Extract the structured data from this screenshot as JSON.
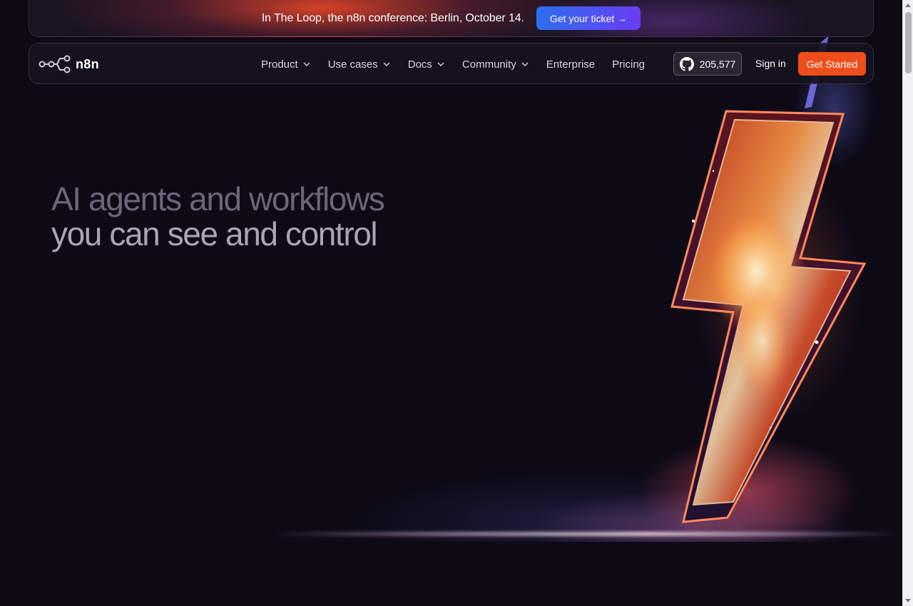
{
  "banner": {
    "text": "In The Loop, the n8n conference: Berlin, October 14.",
    "button_label": "Get your ticket",
    "button_arrow": "→"
  },
  "nav": {
    "logo_text": "n8n",
    "items": [
      {
        "label": "Product",
        "has_dropdown": true
      },
      {
        "label": "Use cases",
        "has_dropdown": true
      },
      {
        "label": "Docs",
        "has_dropdown": true
      },
      {
        "label": "Community",
        "has_dropdown": true
      },
      {
        "label": "Enterprise",
        "has_dropdown": false
      },
      {
        "label": "Pricing",
        "has_dropdown": false
      }
    ],
    "github_stars": "205,577",
    "sign_in": "Sign in",
    "cta": "Get Started"
  },
  "hero": {
    "title_line1": "AI agents and workflows",
    "title_line2": "you can see and control"
  },
  "icons": {
    "logo": "n8n-logo-icon",
    "github": "github-icon",
    "chevron": "chevron-down-icon",
    "hero_art": "lightning-bolt-illustration"
  },
  "colors": {
    "background": "#0d0a16",
    "cta": "#ee4e1c",
    "ticket_gradient_start": "#2d6ef0",
    "ticket_gradient_end": "#6a3cf2",
    "hero_line1": "#6b6578",
    "hero_line2": "#aaa5b4"
  }
}
